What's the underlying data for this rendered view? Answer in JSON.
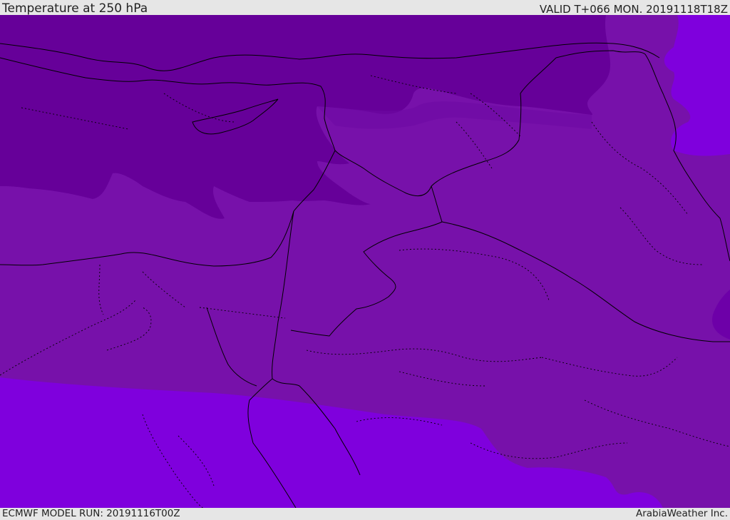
{
  "header": {
    "title": "Temperature at 250 hPa",
    "valid_time": "VALID T+066 MON. 20191118T18Z"
  },
  "footer": {
    "model_run": "ECMWF MODEL RUN: 20191116T00Z",
    "credit": "ArabiaWeather Inc."
  },
  "map": {
    "variable": "temperature",
    "pressure_level": "250 hPa",
    "colors": {
      "coldest_band": "#660099",
      "cold_band": "#7711AA",
      "mid_band": "#7A10B5",
      "warm_band": "#7F00DD",
      "border_line": "#000000"
    }
  }
}
